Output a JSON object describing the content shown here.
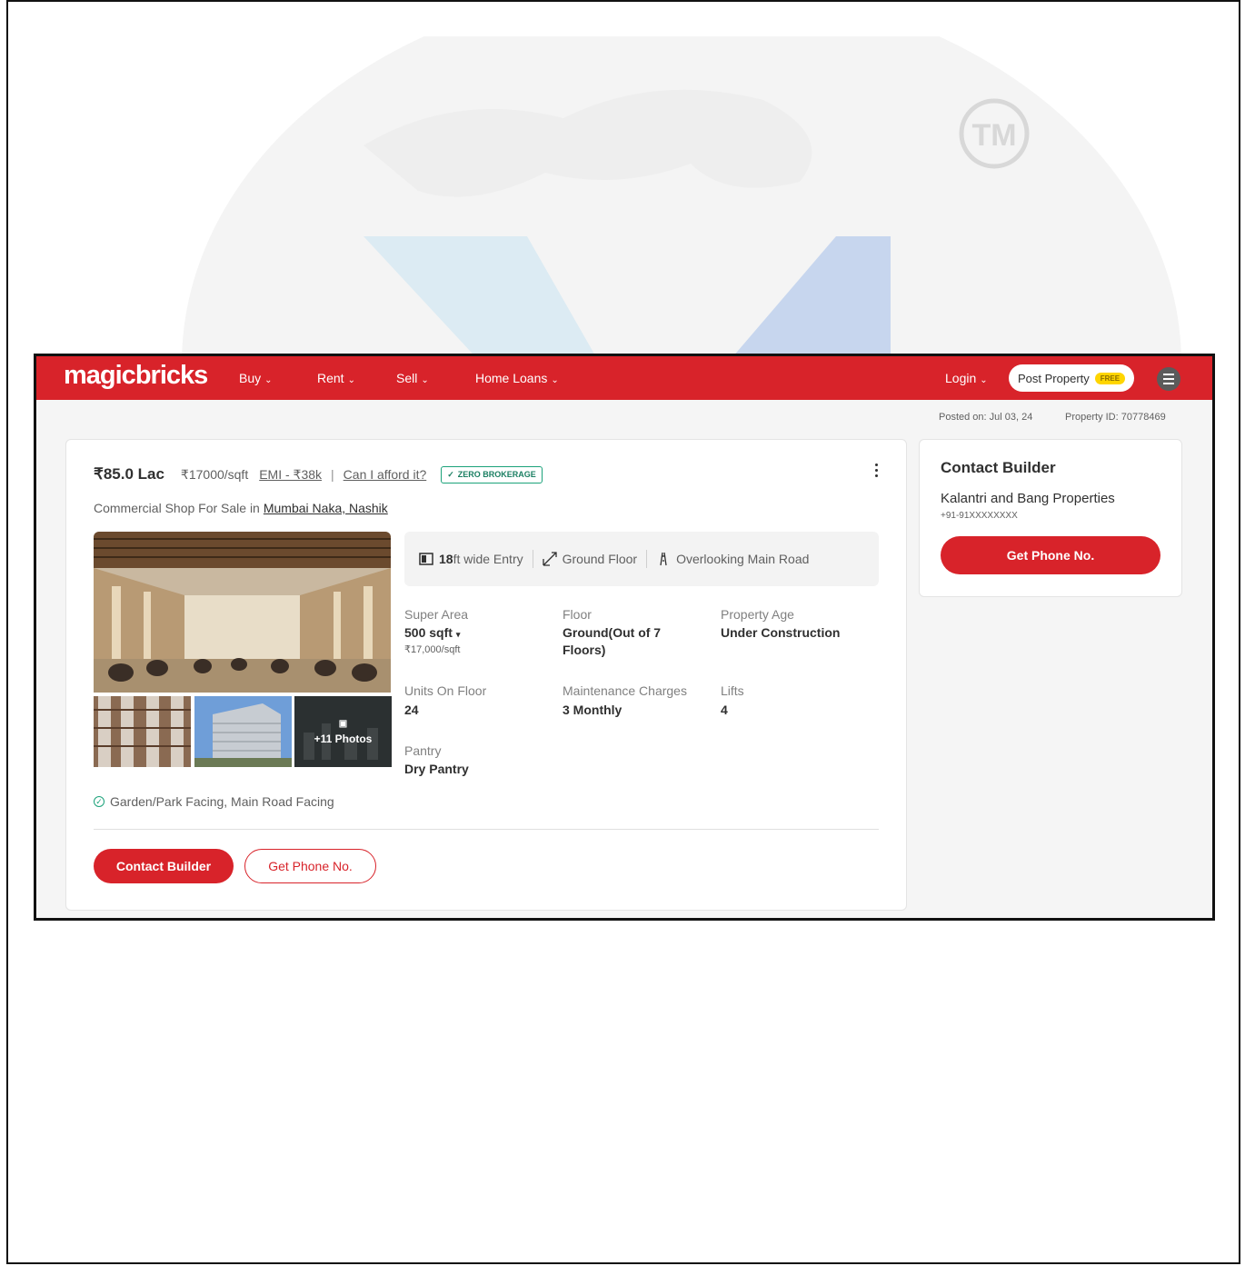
{
  "header": {
    "logo": "magicbricks",
    "nav": [
      {
        "label": "Buy"
      },
      {
        "label": "Rent"
      },
      {
        "label": "Sell"
      },
      {
        "label": "Home Loans"
      }
    ],
    "login_label": "Login",
    "post_property_label": "Post Property",
    "free_badge": "FREE"
  },
  "meta": {
    "posted_on": "Posted on: Jul 03, 24",
    "property_id": "Property ID: 70778469"
  },
  "listing": {
    "price": "₹85.0 Lac",
    "rate": "₹17000/sqft",
    "emi": "EMI - ₹38k",
    "afford": "Can I afford it?",
    "zero_brokerage": "ZERO BROKERAGE",
    "title_prefix": "Commercial Shop For Sale in",
    "location": "Mumbai Naka, Nashik",
    "more_photos": "+11 Photos",
    "amenities": "Garden/Park Facing, Main Road Facing",
    "highlights": {
      "entry_bold": "18",
      "entry_rest": "ft wide Entry",
      "floor": "Ground Floor",
      "overlooking": "Overlooking Main Road"
    },
    "summary": {
      "super_area_label": "Super Area",
      "super_area_value": "500 sqft",
      "super_area_rate": "₹17,000/sqft",
      "floor_label": "Floor",
      "floor_value_1": "Ground(Out of 7",
      "floor_value_2": "Floors)",
      "age_label": "Property Age",
      "age_value": "Under Construction",
      "units_label": "Units On Floor",
      "units_value": "24",
      "maintenance_label": "Maintenance Charges",
      "maintenance_value": "3 Monthly",
      "lifts_label": "Lifts",
      "lifts_value": "4",
      "pantry_label": "Pantry",
      "pantry_value": "Dry Pantry"
    },
    "contact_button": "Contact Builder",
    "phone_button": "Get Phone No."
  },
  "contact_card": {
    "title": "Contact Builder",
    "builder_name": "Kalantri and Bang Properties",
    "phone": "+91-91XXXXXXXX",
    "button": "Get Phone No."
  },
  "watermark_text": "TM",
  "colors": {
    "brand_red": "#d8232a",
    "green": "#1ba27a",
    "free_yellow": "#ffd500"
  }
}
